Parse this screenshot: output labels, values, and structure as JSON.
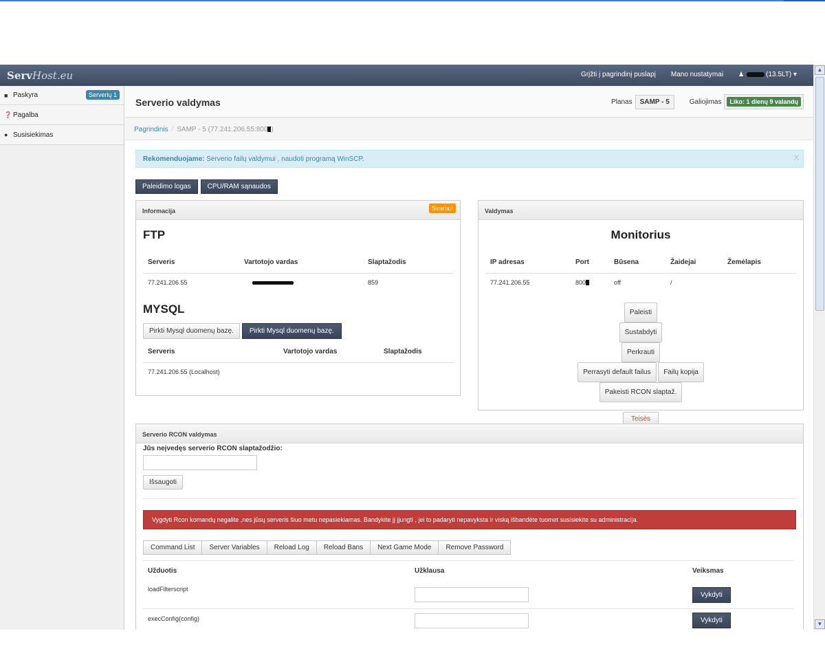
{
  "navbar": {
    "brand_bold": "Serv",
    "brand_italic": "Host.eu",
    "link_home": "Grįžti į pagrindinį puslapį",
    "link_settings": "Mano nustatymai",
    "user_balance": "(13.5LT)",
    "user_caret": "▾",
    "user_icon": "user-icon"
  },
  "sidebar": {
    "items": [
      {
        "label": "Paskyra",
        "icon": "account-icon",
        "badge": "Serverių 1"
      },
      {
        "label": "Pagalba",
        "icon": "help-icon"
      },
      {
        "label": "Susisiekimas",
        "icon": "chat-icon"
      }
    ]
  },
  "header": {
    "title": "Serverio valdymas",
    "plan_label": "Planas",
    "plan_value": "SAMP - 5",
    "validity_label": "Galiojimas",
    "validity_value": "Liko: 1 dienų 9 valandų"
  },
  "breadcrumb": {
    "home": "Pagrindinis",
    "separator": "/",
    "current": "SAMP - 5 (77.241.206.55:800"
  },
  "alert_info": {
    "bold": "Rekomenduojame:",
    "text": " Serverio failų valdymui , naudoti programą WinSCP.",
    "close": "X"
  },
  "tabs": {
    "log_button": "Paleidimo logas",
    "usage_button": "CPU/RAM sąnaudos"
  },
  "info_panel": {
    "title": "Informacija",
    "badge": "Svarbu!",
    "ftp_heading": "FTP",
    "ftp_cols": [
      "Serveris",
      "Vartotojo vardas",
      "Slaptažodis"
    ],
    "ftp_row": {
      "server": "77.241.206.55",
      "password": "859"
    },
    "mysql_heading": "MYSQL",
    "mysql_buy_1": "Pirkti Mysql duomenų bazę.",
    "mysql_buy_2": "Pirkti Mysql duomenų bazę.",
    "mysql_cols": [
      "Serveris",
      "Vartotojo vardas",
      "Slaptažodis"
    ],
    "mysql_row": {
      "server": "77.241.206.55 (Localhost)"
    }
  },
  "control_panel": {
    "title": "Valdymas",
    "heading": "Monitorius",
    "cols": [
      "IP adresas",
      "Port",
      "Būsena",
      "Žaidejai",
      "Žemėlapis"
    ],
    "row": {
      "ip": "77.241.206.55",
      "port": "800",
      "status": "off",
      "players": "/",
      "map": ""
    },
    "btn_start": "Paleisti",
    "btn_stop": "Sustabdyti",
    "btn_restart": "Perkrauti",
    "btn_default": "Perrasyti default failus",
    "btn_backup": "Failų kopija",
    "btn_rcon_pass": "Pakeisti RCON slaptaž.",
    "btn_rights": "Teisės"
  },
  "rcon_panel": {
    "title": "Serverio RCON valdymas",
    "prompt": "Jūs neįvedęs serverio RCON slaptažodžio:",
    "input_value": "",
    "save_button": "Išsaugoti",
    "error": "Vygdyti Rcon komandų negalite ,nes jūsų serveris šiuo metu nepasiekiamas. Bandykite jį įjungti , jei to padaryti nepavyksta ir viską išbandėte tuomet susisiekite su administracija.",
    "commands": [
      "Command List",
      "Server Variables",
      "Reload Log",
      "Reload Bans",
      "Next Game Mode",
      "Remove Password"
    ],
    "table_cols": [
      "Užduotis",
      "Užklausa",
      "Veiksmas"
    ],
    "rows": [
      {
        "task": "loadFilterscript",
        "action": "Vykdyti"
      },
      {
        "task": "execConfig(config)",
        "action": "Vykdyti"
      }
    ]
  },
  "scrollbar": {
    "up": "▲",
    "down": "▼"
  }
}
